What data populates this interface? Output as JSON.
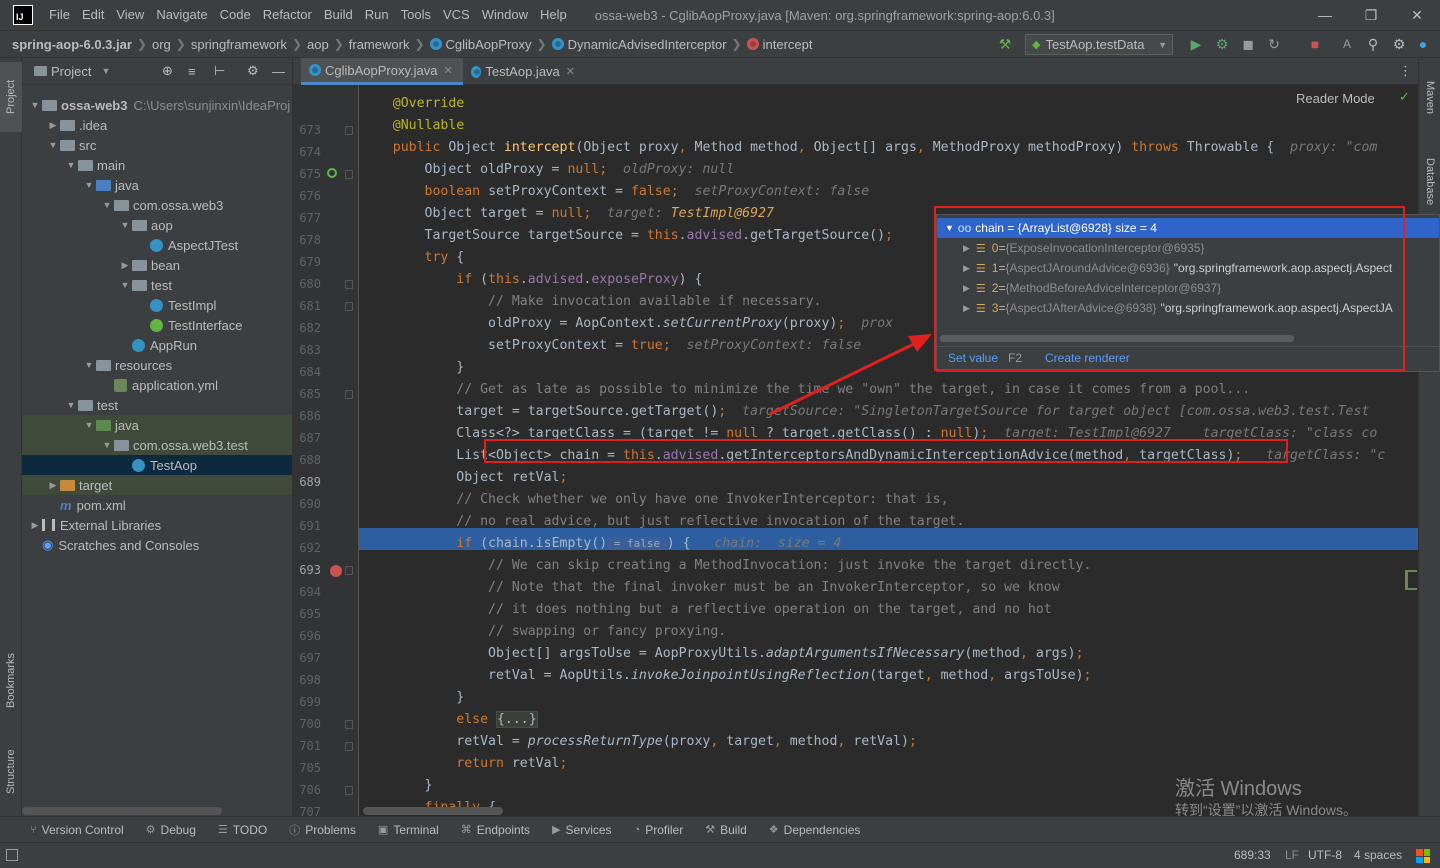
{
  "titlebar": {
    "logo": "IJ",
    "menu": [
      "File",
      "Edit",
      "View",
      "Navigate",
      "Code",
      "Refactor",
      "Build",
      "Run",
      "Tools",
      "VCS",
      "Window",
      "Help"
    ],
    "title": "ossa-web3 - CglibAopProxy.java [Maven: org.springframework:spring-aop:6.0.3]"
  },
  "navbar": {
    "crumbs": [
      "spring-aop-6.0.3.jar",
      "org",
      "springframework",
      "aop",
      "framework",
      "CglibAopProxy",
      "DynamicAdvisedInterceptor",
      "intercept"
    ],
    "run_config": "TestAop.testData"
  },
  "project": {
    "title": "Project",
    "tree": [
      {
        "label": "ossa-web3",
        "path": "C:\\Users\\sunjinxin\\IdeaProj",
        "depth": 0,
        "icon": "folder",
        "open": true,
        "bold": true
      },
      {
        "label": ".idea",
        "depth": 1,
        "icon": "folder",
        "open": false
      },
      {
        "label": "src",
        "depth": 1,
        "icon": "folder",
        "open": true
      },
      {
        "label": "main",
        "depth": 2,
        "icon": "folder",
        "open": true
      },
      {
        "label": "java",
        "depth": 3,
        "icon": "folder-blue",
        "open": true
      },
      {
        "label": "com.ossa.web3",
        "depth": 4,
        "icon": "folder",
        "open": true
      },
      {
        "label": "aop",
        "depth": 5,
        "icon": "folder",
        "open": true
      },
      {
        "label": "AspectJTest",
        "depth": 6,
        "icon": "class"
      },
      {
        "label": "bean",
        "depth": 5,
        "icon": "folder",
        "open": false
      },
      {
        "label": "test",
        "depth": 5,
        "icon": "folder",
        "open": true
      },
      {
        "label": "TestImpl",
        "depth": 6,
        "icon": "class"
      },
      {
        "label": "TestInterface",
        "depth": 6,
        "icon": "interface"
      },
      {
        "label": "AppRun",
        "depth": 5,
        "icon": "class"
      },
      {
        "label": "resources",
        "depth": 3,
        "icon": "folder",
        "open": true
      },
      {
        "label": "application.yml",
        "depth": 4,
        "icon": "yml"
      },
      {
        "label": "test",
        "depth": 2,
        "icon": "folder",
        "open": true
      },
      {
        "label": "java",
        "depth": 3,
        "icon": "folder-green",
        "open": true,
        "highlight": true
      },
      {
        "label": "com.ossa.web3.test",
        "depth": 4,
        "icon": "folder",
        "open": true,
        "highlight": true
      },
      {
        "label": "TestAop",
        "depth": 5,
        "icon": "class",
        "selected": true
      },
      {
        "label": "target",
        "depth": 1,
        "icon": "folder-orange",
        "open": false,
        "highlight": true
      },
      {
        "label": "pom.xml",
        "depth": 1,
        "icon": "maven"
      },
      {
        "label": "External Libraries",
        "depth": 0,
        "icon": "lib",
        "open": false
      },
      {
        "label": "Scratches and Consoles",
        "depth": 0,
        "icon": "scratch"
      }
    ]
  },
  "tabs": [
    {
      "label": "CglibAopProxy.java",
      "active": true
    },
    {
      "label": "TestAop.java",
      "active": false
    }
  ],
  "reader_mode": "Reader Mode",
  "code_lines": [
    {
      "n": "673",
      "t": [
        [
          "    @Override",
          "ann"
        ]
      ]
    },
    {
      "n": "674",
      "t": [
        [
          "    @Nullable",
          "ann"
        ]
      ]
    },
    {
      "n": "675",
      "t": [
        [
          "    ",
          ""
        ],
        [
          "public ",
          "kw"
        ],
        [
          "Object ",
          ""
        ],
        [
          "intercept",
          "fn"
        ],
        [
          "(Object proxy",
          ""
        ],
        [
          ", ",
          "kw"
        ],
        [
          "Method method",
          ""
        ],
        [
          ", ",
          "kw"
        ],
        [
          "Object[] args",
          ""
        ],
        [
          ", ",
          "kw"
        ],
        [
          "MethodProxy methodProxy) ",
          ""
        ],
        [
          "throws ",
          "kw"
        ],
        [
          "Throwable {  ",
          ""
        ],
        [
          "proxy: \"com",
          "hint"
        ]
      ]
    },
    {
      "n": "676",
      "t": [
        [
          "        Object oldProxy = ",
          ""
        ],
        [
          "null",
          "kw"
        ],
        [
          ";  ",
          "kw"
        ],
        [
          "oldProxy: null",
          "hint"
        ]
      ]
    },
    {
      "n": "677",
      "t": [
        [
          "        ",
          ""
        ],
        [
          "boolean ",
          "kw"
        ],
        [
          "setProxyContext = ",
          ""
        ],
        [
          "false",
          "kw"
        ],
        [
          ";  ",
          "kw"
        ],
        [
          "setProxyContext: false",
          "hint"
        ]
      ]
    },
    {
      "n": "678",
      "t": [
        [
          "        Object target = ",
          ""
        ],
        [
          "null",
          "kw"
        ],
        [
          ";  ",
          "kw"
        ],
        [
          "target: ",
          "hint"
        ],
        [
          "TestImpl@6927",
          "hintv"
        ]
      ]
    },
    {
      "n": "679",
      "t": [
        [
          "        TargetSource targetSource = ",
          ""
        ],
        [
          "this",
          "kw"
        ],
        [
          ".",
          ""
        ],
        [
          "advised",
          "fld"
        ],
        [
          ".getTargetSource()",
          ""
        ],
        [
          ";",
          "kw"
        ]
      ]
    },
    {
      "n": "680",
      "t": [
        [
          "        ",
          ""
        ],
        [
          "try ",
          "kw"
        ],
        [
          "{",
          ""
        ]
      ]
    },
    {
      "n": "681",
      "t": [
        [
          "            ",
          ""
        ],
        [
          "if ",
          "kw"
        ],
        [
          "(",
          ""
        ],
        [
          "this",
          "kw"
        ],
        [
          ".",
          ""
        ],
        [
          "advised",
          "fld"
        ],
        [
          ".",
          ""
        ],
        [
          "exposeProxy",
          "fld"
        ],
        [
          ") {",
          ""
        ]
      ]
    },
    {
      "n": "682",
      "t": [
        [
          "                // Make invocation available if necessary.",
          "cmt"
        ]
      ]
    },
    {
      "n": "683",
      "t": [
        [
          "                oldProxy = AopContext.",
          ""
        ],
        [
          "setCurrentProxy",
          "ital"
        ],
        [
          "(proxy)",
          ""
        ],
        [
          ";  ",
          "kw"
        ],
        [
          "prox",
          "hint"
        ]
      ]
    },
    {
      "n": "684",
      "t": [
        [
          "                setProxyContext = ",
          ""
        ],
        [
          "true",
          "kw"
        ],
        [
          ";  ",
          "kw"
        ],
        [
          "setProxyContext: false",
          "hint"
        ]
      ]
    },
    {
      "n": "685",
      "t": [
        [
          "            }",
          ""
        ]
      ]
    },
    {
      "n": "686",
      "t": [
        [
          "            // Get as late as possible to minimize the time we \"own\" the target, in case it comes from a pool...",
          "cmt"
        ]
      ]
    },
    {
      "n": "687",
      "t": [
        [
          "            target = targetSource.getTarget()",
          ""
        ],
        [
          ";  ",
          "kw"
        ],
        [
          "targetSource: \"SingletonTargetSource for target object [com.ossa.web3.test.Test",
          "hint"
        ]
      ]
    },
    {
      "n": "688",
      "t": [
        [
          "            Class<?> targetClass = (target != ",
          ""
        ],
        [
          "null ",
          "kw"
        ],
        [
          "? target.getClass() : ",
          ""
        ],
        [
          "null",
          "kw"
        ],
        [
          ")",
          ""
        ],
        [
          ";  ",
          "kw"
        ],
        [
          "target: TestImpl@6927    targetClass: \"class co",
          "hint"
        ]
      ]
    },
    {
      "n": "689",
      "t": [
        [
          "            List<Object> chain = ",
          ""
        ],
        [
          "this",
          "kw"
        ],
        [
          ".",
          ""
        ],
        [
          "advised",
          "fld"
        ],
        [
          ".getInterceptorsAndDynamicInterceptionAdvice(method",
          ""
        ],
        [
          ", ",
          "kw"
        ],
        [
          "targetClass)",
          ""
        ],
        [
          ";",
          "kw"
        ],
        [
          "   targetClass: \"c",
          "hint"
        ]
      ]
    },
    {
      "n": "690",
      "t": [
        [
          "            Object retVal",
          ""
        ],
        [
          ";",
          "kw"
        ]
      ]
    },
    {
      "n": "691",
      "t": [
        [
          "            // Check whether we only have one InvokerInterceptor: that is,",
          "cmt"
        ]
      ]
    },
    {
      "n": "692",
      "t": [
        [
          "            // no real advice, but just reflective invocation of the target.",
          "cmt"
        ]
      ]
    },
    {
      "n": "693",
      "t": [
        [
          "            ",
          ""
        ],
        [
          "if ",
          "kw"
        ],
        [
          "(chain.isEmpty()",
          ""
        ],
        [
          " = false ",
          "inl"
        ],
        [
          ") {   ",
          ""
        ],
        [
          "chain:  size = 4",
          "hint"
        ]
      ],
      "exec": true
    },
    {
      "n": "694",
      "t": [
        [
          "                // We can skip creating a MethodInvocation: just invoke the target directly.",
          "cmt"
        ]
      ]
    },
    {
      "n": "695",
      "t": [
        [
          "                // Note that the final invoker must be an InvokerInterceptor, so we know",
          "cmt"
        ]
      ]
    },
    {
      "n": "696",
      "t": [
        [
          "                // it does nothing but a reflective operation on the target, and no hot",
          "cmt"
        ]
      ]
    },
    {
      "n": "697",
      "t": [
        [
          "                // swapping or fancy proxying.",
          "cmt"
        ]
      ]
    },
    {
      "n": "698",
      "t": [
        [
          "                Object[] argsToUse = AopProxyUtils.",
          ""
        ],
        [
          "adaptArgumentsIfNecessary",
          "ital"
        ],
        [
          "(method",
          ""
        ],
        [
          ", ",
          "kw"
        ],
        [
          "args)",
          ""
        ],
        [
          ";",
          "kw"
        ]
      ]
    },
    {
      "n": "699",
      "t": [
        [
          "                retVal = AopUtils.",
          ""
        ],
        [
          "invokeJoinpointUsingReflection",
          "ital"
        ],
        [
          "(target",
          ""
        ],
        [
          ", ",
          "kw"
        ],
        [
          "method",
          ""
        ],
        [
          ", ",
          "kw"
        ],
        [
          "argsToUse)",
          ""
        ],
        [
          ";",
          "kw"
        ]
      ]
    },
    {
      "n": "700",
      "t": [
        [
          "            }",
          ""
        ]
      ]
    },
    {
      "n": "701",
      "t": [
        [
          "            ",
          ""
        ],
        [
          "else ",
          "kw"
        ],
        [
          "{...}",
          "fold"
        ]
      ]
    },
    {
      "n": "705",
      "t": [
        [
          "            retVal = ",
          ""
        ],
        [
          "processReturnType",
          "ital"
        ],
        [
          "(proxy",
          ""
        ],
        [
          ", ",
          "kw"
        ],
        [
          "target",
          ""
        ],
        [
          ", ",
          "kw"
        ],
        [
          "method",
          ""
        ],
        [
          ", ",
          "kw"
        ],
        [
          "retVal)",
          ""
        ],
        [
          ";",
          "kw"
        ]
      ]
    },
    {
      "n": "706",
      "t": [
        [
          "            ",
          ""
        ],
        [
          "return ",
          "kw"
        ],
        [
          "retVal",
          ""
        ],
        [
          ";",
          "kw"
        ]
      ]
    },
    {
      "n": "707",
      "t": [
        [
          "        }",
          ""
        ]
      ]
    },
    {
      "n": "708",
      "t": [
        [
          "        ",
          ""
        ],
        [
          "finally ",
          "kw"
        ],
        [
          "{",
          ""
        ]
      ]
    }
  ],
  "debug_popup": {
    "header": "chain = {ArrayList@6928}  size = 4",
    "items": [
      {
        "index": "0",
        "ref": "{ExposeInvocationInterceptor@6935}",
        "value": ""
      },
      {
        "index": "1",
        "ref": "{AspectJAroundAdvice@6936}",
        "value": "\"org.springframework.aop.aspectj.Aspect"
      },
      {
        "index": "2",
        "ref": "{MethodBeforeAdviceInterceptor@6937}",
        "value": ""
      },
      {
        "index": "3",
        "ref": "{AspectJAfterAdvice@6938}",
        "value": "\"org.springframework.aop.aspectj.AspectJA"
      }
    ],
    "set_value": "Set value",
    "set_value_key": "F2",
    "create_renderer": "Create renderer"
  },
  "bottom_tabs": [
    "Version Control",
    "Debug",
    "TODO",
    "Problems",
    "Terminal",
    "Endpoints",
    "Services",
    "Profiler",
    "Build",
    "Dependencies"
  ],
  "statusbar": {
    "position": "689:33",
    "line_sep": "LF",
    "encoding": "UTF-8",
    "indent": "4 spaces"
  },
  "watermark": {
    "line1": "激活 Windows",
    "line2": "转到“设置”以激活 Windows。"
  },
  "strips": {
    "left": [
      "Project",
      "Bookmarks",
      "Structure"
    ],
    "right": [
      "Maven",
      "Database"
    ]
  },
  "colors": {
    "keyword": "#cc7832",
    "annotation": "#bbb529",
    "function": "#ffc66d",
    "field": "#9876aa",
    "comment": "#808080",
    "hint_value": "#d8a656",
    "exec_line": "#2d5fa0",
    "red_box": "#e0201e"
  }
}
